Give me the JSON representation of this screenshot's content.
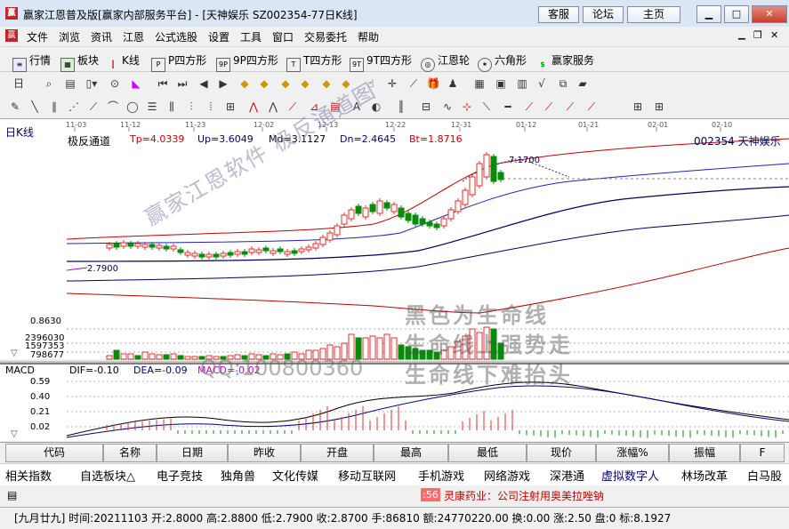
{
  "window": {
    "title": "赢家江恩普及版[赢家内部服务平台] - [天神娱乐  SZ002354-77日K线]",
    "top_buttons": [
      "客服",
      "论坛",
      "主页"
    ]
  },
  "menubar": {
    "items": [
      "文件",
      "浏览",
      "资讯",
      "江恩",
      "公式选股",
      "设置",
      "工具",
      "窗口",
      "交易委托",
      "帮助"
    ]
  },
  "funcbar": {
    "items": [
      "行情",
      "板块",
      "K线",
      "P四方形",
      "9P四方形",
      "T四方形",
      "9T四方形",
      "江恩轮",
      "六角形",
      "赢家服务"
    ]
  },
  "chart": {
    "period_label": "日K线",
    "indicator_name": "极反通道",
    "indicator_values": {
      "tp": "Tp=4.0339",
      "up": "Up=3.6049",
      "md": "Md=3.1127",
      "dn": "Dn=2.4645",
      "bt": "Bt=1.8716"
    },
    "stock_label": "002354  天神娱乐",
    "dates": [
      "11-03",
      "11-12",
      "11-23",
      "12-02",
      "12-13",
      "12-22",
      "12-31",
      "01-12",
      "01-21",
      "02-01",
      "02-10"
    ],
    "high_label": "7.1700",
    "low_label": "2.7900",
    "volume_ticks": [
      "0.8630",
      "2396030",
      "1597353",
      "798677"
    ],
    "macd": {
      "label": "MACD",
      "dif": "DIF=-0.10",
      "dea": "DEA=-0.09",
      "macd": "MACD=-0.02",
      "ticks": [
        "0.59",
        "0.40",
        "0.21",
        "0.02"
      ]
    },
    "watermarks": {
      "diagonal": "赢家江恩软件  极反通道图",
      "line1": "黑色为生命线",
      "line2": "生命线上强势走",
      "line3": "生命线下难抬头",
      "qq": "QQ:100800360"
    },
    "colors": {
      "up": "#e03030",
      "down": "#0a8a0a",
      "channel_outer": "#c00000",
      "channel_mid": "#000060",
      "channel_blue": "#2020c0"
    }
  },
  "columns": [
    "代码",
    "名称",
    "日期",
    "昨收",
    "开盘",
    "最高",
    "最低",
    "现价",
    "涨幅%",
    "振幅",
    "F"
  ],
  "boards": [
    "相关指数",
    "自选板块△",
    "电子竞技",
    "独角兽",
    "文化传媒",
    "移动互联网",
    "手机游戏",
    "网络游戏",
    "深港通",
    "虚拟数字人",
    "林场改革",
    "白马股"
  ],
  "news": {
    "badge": ":56",
    "text": "灵康药业：公司注射用奥美拉唑钠"
  },
  "status": {
    "text": "[九月廿九] 时间:20211103 开:2.8000 高:2.8800 低:2.7900 收:2.8700 手:86810 额:24770220.00 换:0.00 涨:2.50 盘:0 标:8.1927"
  }
}
